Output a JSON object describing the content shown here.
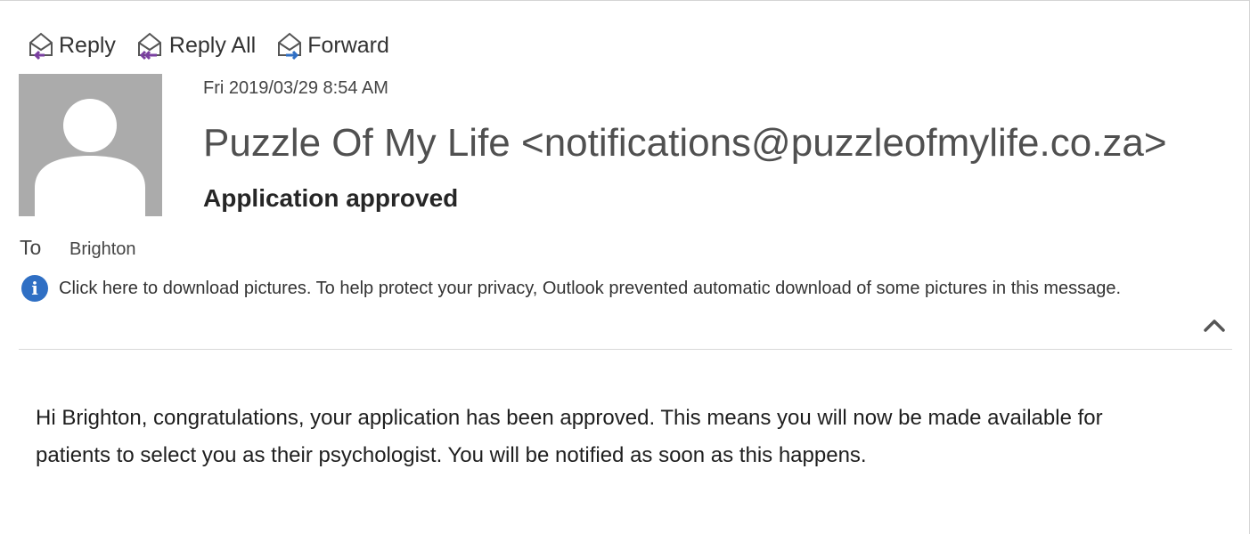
{
  "toolbar": {
    "reply_label": "Reply",
    "reply_all_label": "Reply All",
    "forward_label": "Forward"
  },
  "message": {
    "date": "Fri 2019/03/29 8:54 AM",
    "sender": "Puzzle Of My Life <notifications@puzzleofmylife.co.za>",
    "subject": "Application approved",
    "to_label": "To",
    "to_name": "Brighton",
    "info_text": "Click here to download pictures. To help protect your privacy, Outlook prevented automatic download of some pictures in this message.",
    "body": "Hi Brighton, congratulations, your application has been approved. This means you will now be made available for patients to select you as their psychologist. You will be notified as soon as this happens."
  },
  "icons": {
    "reply": "reply-icon",
    "reply_all": "reply-all-icon",
    "forward": "forward-icon",
    "info": "info-icon",
    "collapse": "chevron-up-icon"
  },
  "colors": {
    "avatar_bg": "#ababab",
    "info_blue": "#2f6fc4",
    "reply_arrow": "#7a3fa0",
    "forward_arrow": "#2f6fc4"
  }
}
